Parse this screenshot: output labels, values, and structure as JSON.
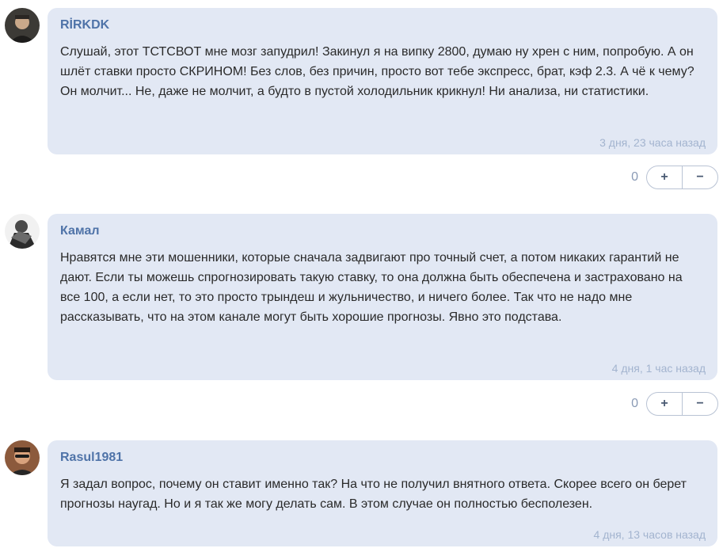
{
  "comments": [
    {
      "author": "RİRKDK",
      "text": "Слушай, этот ТСТСВОТ мне мозг запудрил! Закинул я на випку 2800, думаю ну хрен с ним, попробую. А он шлёт ставки просто СКРИНОМ! Без слов, без причин, просто вот тебе экспресс, брат, кэф 2.3. А чё к чему? Он молчит... Не, даже не молчит, а будто в пустой холодильник крикнул! Ни анализа, ни статистики.",
      "time": "3 дня, 23 часа назад",
      "votes": "0",
      "plus": "+",
      "minus": "−"
    },
    {
      "author": "Камал",
      "text": "Нравятся мне эти мошенники, которые сначала задвигают про точный счет, а потом никаких гарантий не дают. Если ты можешь спрогнозировать такую ставку, то она должна быть обеспечена и застраховано на все 100, а если нет, то это просто трындеш и жульничество, и ничего более. Так что не надо мне рассказывать, что на этом канале могут быть хорошие прогнозы. Явно это подстава.",
      "time": "4 дня, 1 час назад",
      "votes": "0",
      "plus": "+",
      "minus": "−"
    },
    {
      "author": "Rasul1981",
      "text": "Я задал вопрос, почему он ставит именно так? На что не получил внятного ответа. Скорее всего он берет прогнозы наугад. Но и я так же могу делать сам. В этом случае он полностью бесполезен.",
      "time": "4 дня, 13 часов назад"
    }
  ]
}
